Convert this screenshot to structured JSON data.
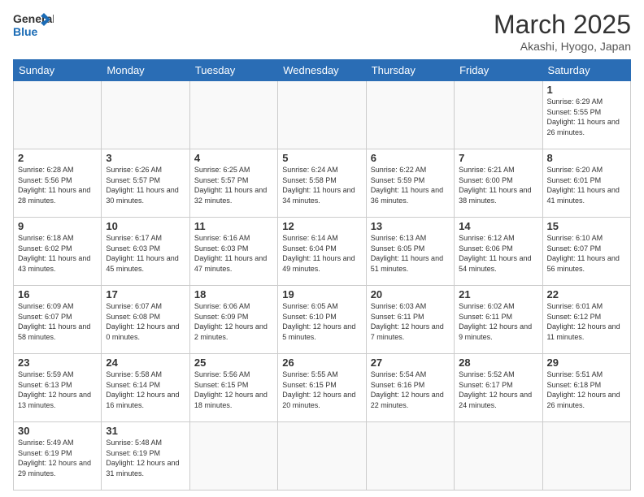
{
  "header": {
    "logo_general": "General",
    "logo_blue": "Blue",
    "month_title": "March 2025",
    "location": "Akashi, Hyogo, Japan"
  },
  "weekdays": [
    "Sunday",
    "Monday",
    "Tuesday",
    "Wednesday",
    "Thursday",
    "Friday",
    "Saturday"
  ],
  "weeks": [
    [
      {
        "day": "",
        "info": ""
      },
      {
        "day": "",
        "info": ""
      },
      {
        "day": "",
        "info": ""
      },
      {
        "day": "",
        "info": ""
      },
      {
        "day": "",
        "info": ""
      },
      {
        "day": "",
        "info": ""
      },
      {
        "day": "1",
        "info": "Sunrise: 6:29 AM\nSunset: 5:55 PM\nDaylight: 11 hours and 26 minutes."
      }
    ],
    [
      {
        "day": "2",
        "info": "Sunrise: 6:28 AM\nSunset: 5:56 PM\nDaylight: 11 hours and 28 minutes."
      },
      {
        "day": "3",
        "info": "Sunrise: 6:26 AM\nSunset: 5:57 PM\nDaylight: 11 hours and 30 minutes."
      },
      {
        "day": "4",
        "info": "Sunrise: 6:25 AM\nSunset: 5:57 PM\nDaylight: 11 hours and 32 minutes."
      },
      {
        "day": "5",
        "info": "Sunrise: 6:24 AM\nSunset: 5:58 PM\nDaylight: 11 hours and 34 minutes."
      },
      {
        "day": "6",
        "info": "Sunrise: 6:22 AM\nSunset: 5:59 PM\nDaylight: 11 hours and 36 minutes."
      },
      {
        "day": "7",
        "info": "Sunrise: 6:21 AM\nSunset: 6:00 PM\nDaylight: 11 hours and 38 minutes."
      },
      {
        "day": "8",
        "info": "Sunrise: 6:20 AM\nSunset: 6:01 PM\nDaylight: 11 hours and 41 minutes."
      }
    ],
    [
      {
        "day": "9",
        "info": "Sunrise: 6:18 AM\nSunset: 6:02 PM\nDaylight: 11 hours and 43 minutes."
      },
      {
        "day": "10",
        "info": "Sunrise: 6:17 AM\nSunset: 6:03 PM\nDaylight: 11 hours and 45 minutes."
      },
      {
        "day": "11",
        "info": "Sunrise: 6:16 AM\nSunset: 6:03 PM\nDaylight: 11 hours and 47 minutes."
      },
      {
        "day": "12",
        "info": "Sunrise: 6:14 AM\nSunset: 6:04 PM\nDaylight: 11 hours and 49 minutes."
      },
      {
        "day": "13",
        "info": "Sunrise: 6:13 AM\nSunset: 6:05 PM\nDaylight: 11 hours and 51 minutes."
      },
      {
        "day": "14",
        "info": "Sunrise: 6:12 AM\nSunset: 6:06 PM\nDaylight: 11 hours and 54 minutes."
      },
      {
        "day": "15",
        "info": "Sunrise: 6:10 AM\nSunset: 6:07 PM\nDaylight: 11 hours and 56 minutes."
      }
    ],
    [
      {
        "day": "16",
        "info": "Sunrise: 6:09 AM\nSunset: 6:07 PM\nDaylight: 11 hours and 58 minutes."
      },
      {
        "day": "17",
        "info": "Sunrise: 6:07 AM\nSunset: 6:08 PM\nDaylight: 12 hours and 0 minutes."
      },
      {
        "day": "18",
        "info": "Sunrise: 6:06 AM\nSunset: 6:09 PM\nDaylight: 12 hours and 2 minutes."
      },
      {
        "day": "19",
        "info": "Sunrise: 6:05 AM\nSunset: 6:10 PM\nDaylight: 12 hours and 5 minutes."
      },
      {
        "day": "20",
        "info": "Sunrise: 6:03 AM\nSunset: 6:11 PM\nDaylight: 12 hours and 7 minutes."
      },
      {
        "day": "21",
        "info": "Sunrise: 6:02 AM\nSunset: 6:11 PM\nDaylight: 12 hours and 9 minutes."
      },
      {
        "day": "22",
        "info": "Sunrise: 6:01 AM\nSunset: 6:12 PM\nDaylight: 12 hours and 11 minutes."
      }
    ],
    [
      {
        "day": "23",
        "info": "Sunrise: 5:59 AM\nSunset: 6:13 PM\nDaylight: 12 hours and 13 minutes."
      },
      {
        "day": "24",
        "info": "Sunrise: 5:58 AM\nSunset: 6:14 PM\nDaylight: 12 hours and 16 minutes."
      },
      {
        "day": "25",
        "info": "Sunrise: 5:56 AM\nSunset: 6:15 PM\nDaylight: 12 hours and 18 minutes."
      },
      {
        "day": "26",
        "info": "Sunrise: 5:55 AM\nSunset: 6:15 PM\nDaylight: 12 hours and 20 minutes."
      },
      {
        "day": "27",
        "info": "Sunrise: 5:54 AM\nSunset: 6:16 PM\nDaylight: 12 hours and 22 minutes."
      },
      {
        "day": "28",
        "info": "Sunrise: 5:52 AM\nSunset: 6:17 PM\nDaylight: 12 hours and 24 minutes."
      },
      {
        "day": "29",
        "info": "Sunrise: 5:51 AM\nSunset: 6:18 PM\nDaylight: 12 hours and 26 minutes."
      }
    ],
    [
      {
        "day": "30",
        "info": "Sunrise: 5:49 AM\nSunset: 6:19 PM\nDaylight: 12 hours and 29 minutes."
      },
      {
        "day": "31",
        "info": "Sunrise: 5:48 AM\nSunset: 6:19 PM\nDaylight: 12 hours and 31 minutes."
      },
      {
        "day": "",
        "info": ""
      },
      {
        "day": "",
        "info": ""
      },
      {
        "day": "",
        "info": ""
      },
      {
        "day": "",
        "info": ""
      },
      {
        "day": "",
        "info": ""
      }
    ]
  ]
}
